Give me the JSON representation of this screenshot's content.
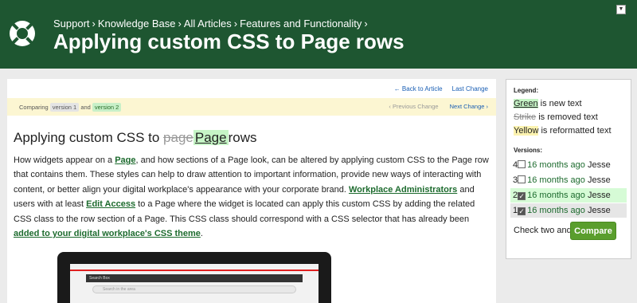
{
  "header": {
    "breadcrumbs": [
      "Support",
      "Knowledge Base",
      "All Articles",
      "Features and Functionality"
    ],
    "separator": "›",
    "title": "Applying custom CSS to Page rows",
    "brand_color": "#1e5631"
  },
  "nav": {
    "back_link": "← Back to Article",
    "last_change": "Last Change"
  },
  "compare_bar": {
    "comparing": "Comparing",
    "old_version": "version 1",
    "and": "and",
    "new_version": "version 2",
    "prev_change": "‹ Previous Change",
    "next_change": "Next Change ›"
  },
  "article": {
    "title_prefix": "Applying custom CSS to",
    "title_removed": "page",
    "title_added": "Page",
    "title_suffix": "rows",
    "p1": "How widgets appear on a",
    "link_page": "Page",
    "p2": ", and how sections of a Page look, can be altered by applying custom CSS to the Page row that contains them. These styles can help to draw attention to important information, provide new ways of interacting with content, or better align your digital workplace's appearance with your corporate brand.",
    "link_admins": "Workplace Administrators",
    "p3": "and users with at least",
    "link_edit": "Edit Access",
    "p4": "to a Page where the widget is located can apply this custom CSS by adding the related CSS class to the row section of a Page. This CSS class should correspond with a CSS selector that has already been",
    "link_theme": "added to your digital workplace's CSS theme",
    "p5": "."
  },
  "laptop": {
    "app_title": "Search Box",
    "search_placeholder": "Search in the area"
  },
  "legend": {
    "heading": "Legend:",
    "green_word": "Green",
    "green_text": "is new text",
    "strike_word": "Strike",
    "strike_text": "is removed text",
    "yellow_word": "Yellow",
    "yellow_text": "is reformatted text"
  },
  "versions": {
    "heading": "Versions:",
    "items": [
      {
        "num": "4",
        "when": "16 months ago",
        "author": "Jesse",
        "checked": false
      },
      {
        "num": "3",
        "when": "16 months ago",
        "author": "Jesse",
        "checked": false
      },
      {
        "num": "2",
        "when": "16 months ago",
        "author": "Jesse",
        "checked": true
      },
      {
        "num": "1",
        "when": "16 months ago",
        "author": "Jesse",
        "checked": true
      }
    ],
    "check_two": "Check two and",
    "compare_button": "Compare"
  }
}
